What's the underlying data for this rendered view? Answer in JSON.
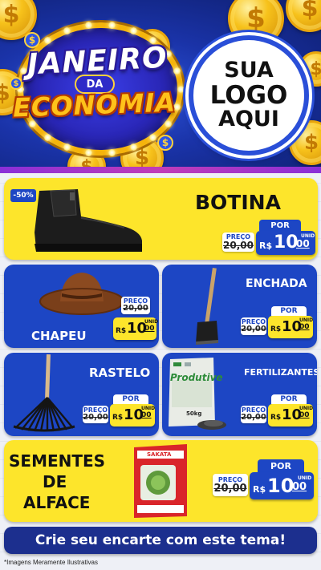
{
  "header": {
    "title_line1": "JANEIRO",
    "title_line2": "DA",
    "title_line3": "ECONOMIA",
    "logo_line1": "SUA",
    "logo_line2": "LOGO",
    "logo_line3": "AQUI",
    "coin_symbol": "$"
  },
  "products": [
    {
      "name": "BOTINA",
      "discount": "-50%",
      "old_label": "PREÇO",
      "old_price": "20,00",
      "por_label": "POR",
      "currency": "R$",
      "price_int": "10",
      "price_cents": "00",
      "unit": "UNID",
      "icon": "boot-icon"
    },
    {
      "name": "CHAPEU",
      "old_label": "PREÇO",
      "old_price": "20,00",
      "por_label": "POR",
      "currency": "R$",
      "price_int": "10",
      "price_cents": "00",
      "unit": "UNID",
      "icon": "hat-icon"
    },
    {
      "name": "ENCHADA",
      "old_label": "PREÇO",
      "old_price": "20,00",
      "por_label": "POR",
      "currency": "R$",
      "price_int": "10",
      "price_cents": "00",
      "unit": "UNID",
      "icon": "hoe-icon"
    },
    {
      "name": "RASTELO",
      "old_label": "PREÇO",
      "old_price": "20,00",
      "por_label": "POR",
      "currency": "R$",
      "price_int": "10",
      "price_cents": "00",
      "unit": "UNID",
      "icon": "rake-icon"
    },
    {
      "name": "FERTILIZANTES",
      "old_label": "PREÇO",
      "old_price": "20,00",
      "por_label": "POR",
      "currency": "R$",
      "price_int": "10",
      "price_cents": "00",
      "unit": "UNID",
      "icon": "fertilizer-bag-icon",
      "bag_brand": "Produtive",
      "bag_weight": "50kg"
    },
    {
      "name_line1": "SEMENTES",
      "name_line2": "DE",
      "name_line3": "ALFACE",
      "old_label": "PREÇO",
      "old_price": "20,00",
      "por_label": "POR",
      "currency": "R$",
      "price_int": "10",
      "price_cents": "00",
      "unit": "UNID",
      "icon": "seed-packet-icon",
      "packet_brand": "SAKATA"
    }
  ],
  "cta": {
    "label": "Crie seu encarte com este tema!"
  },
  "footnote": "*Imagens Meramente Ilustrativas",
  "colors": {
    "yellow": "#fde52b",
    "blue": "#1d46c4",
    "navy": "#1c2f8e"
  }
}
